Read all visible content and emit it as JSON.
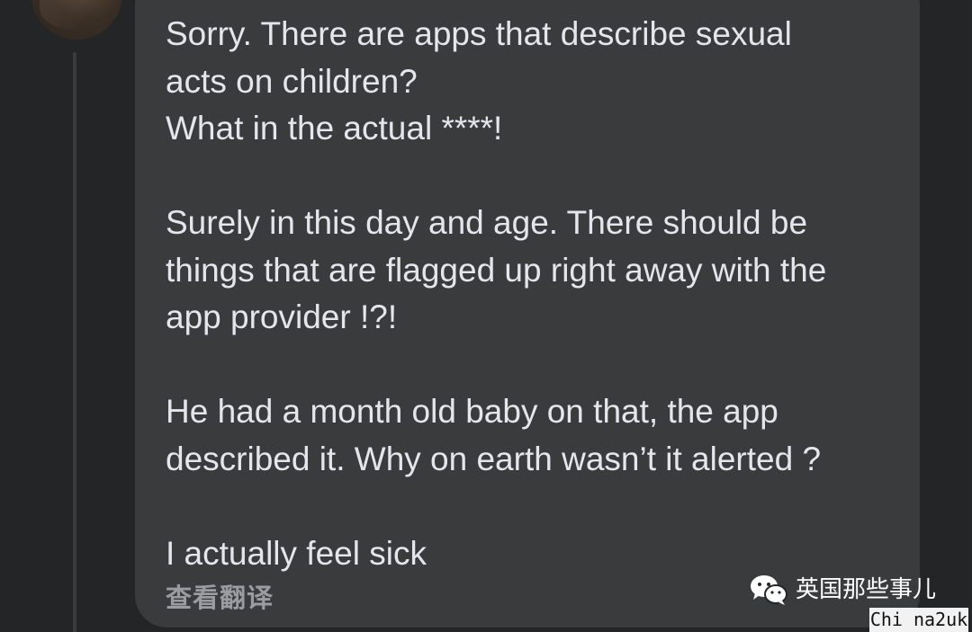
{
  "comment": {
    "paragraphs": [
      "Sorry. There are apps that describe sexual\nacts on children?\nWhat in the actual ****!",
      "Surely in this day and age. There should be\nthings that are flagged up right away with the\napp provider !?!",
      "He had a month old baby on that, the app\ndescribed it. Why on earth wasn’t it alerted ?",
      "I actually feel sick"
    ],
    "see_translation": "查看翻译"
  },
  "watermark": {
    "account_name": "英国那些事儿",
    "icon": "wechat-icon",
    "site_label": "Chi na2uk"
  },
  "colors": {
    "background": "#242526",
    "bubble": "#3a3b3c",
    "text": "#e4e6eb",
    "secondary_text": "#9a9c9f"
  }
}
